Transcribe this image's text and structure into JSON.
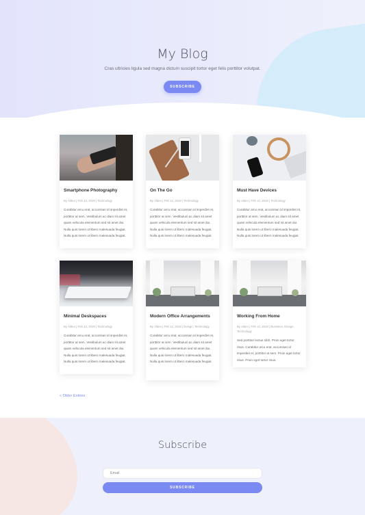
{
  "hero": {
    "title": "My Blog",
    "subtitle": "Cras ultricies ligula sed magna dictum suscipit tortor eget felis porttitor volutpat.",
    "button": "SUBSCRIBE"
  },
  "posts": [
    {
      "title": "Smartphone Photography",
      "meta": "By Alden | Feb 12, 2018 | Technology",
      "excerpt": "Curabitur arcu erat, accumsan id imperdiet et, porttitor at sem. Vestibulum ac diam sit amet quam vehicula elementum sed sit amet dui. Nulla quis lorem ut libero malesuada feugiat. Nulla quis lorem ut libero malesuada feugiat."
    },
    {
      "title": "On The Go",
      "meta": "By Alden | Feb 12, 2018 | Technology",
      "excerpt": "Curabitur arcu erat, accumsan id imperdiet et, porttitor at sem. Vestibulum ac diam sit amet quam vehicula elementum sed sit amet dui. Nulla quis lorem ut libero malesuada feugiat. Nulla quis lorem ut libero malesuada feugiat."
    },
    {
      "title": "Must Have Devices",
      "meta": "By Alden | Feb 12, 2018 | Technology",
      "excerpt": "Curabitur arcu erat, accumsan id imperdiet et, porttitor at sem. Vestibulum ac diam sit amet quam vehicula elementum sed sit amet dui. Nulla quis lorem ut libero malesuada feugiat. Nulla quis lorem ut libero malesuada feugiat."
    },
    {
      "title": "Minimal Deskspaces",
      "meta": "By Alden | Feb 12, 2018 | Technology",
      "excerpt": "Curabitur arcu erat, accumsan id imperdiet et, porttitor at sem. Vestibulum ac diam sit amet quam vehicula elementum sed sit amet dui. Nulla quis lorem ut libero malesuada feugiat. Nulla quis lorem ut libero malesuada feugiat."
    },
    {
      "title": "Modern Office Arrangements",
      "meta": "By Alden | Feb 12, 2018 | Design, Technology",
      "excerpt": "Curabitur arcu erat, accumsan id imperdiet et, porttitor at sem. Vestibulum ac diam sit amet quam vehicula elementum sed sit amet dui. Nulla quis lorem ut libero malesuada feugiat. Nulla quis lorem ut libero malesuada feugiat."
    },
    {
      "title": "Working From Home",
      "meta": "By Alden | Feb 12, 2018 | Business, Design, Technology",
      "excerpt": "Sed porttitor lectus nibh. Proin eget tortor risus. Curabitur arcu erat, accumsan id imperdiet et, porttitor at sem. Proin eget tortor risus. Proin eget tortor risus."
    }
  ],
  "pagination": {
    "older": "« Older Entries"
  },
  "subscribe": {
    "title": "Subscribe",
    "email_placeholder": "Email",
    "button": "SUBSCRIBE"
  },
  "colors": {
    "accent": "#7b8af3"
  }
}
